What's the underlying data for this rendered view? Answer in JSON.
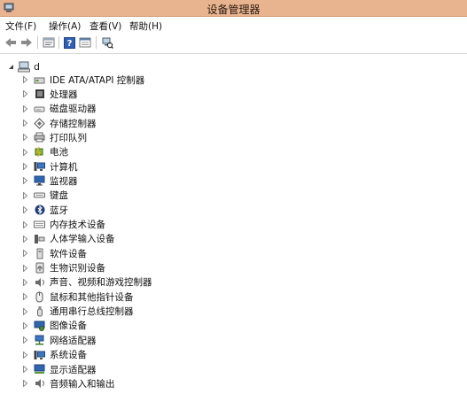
{
  "window": {
    "title": "设备管理器"
  },
  "menu": [
    {
      "label": "文件(F)"
    },
    {
      "label": "操作(A)"
    },
    {
      "label": "查看(V)"
    },
    {
      "label": "帮助(H)"
    }
  ],
  "toolbar": [
    {
      "icon": "back-arrow-icon"
    },
    {
      "icon": "forward-arrow-icon"
    },
    {
      "icon": "properties-icon"
    },
    {
      "icon": "help-icon"
    },
    {
      "icon": "details-view-icon"
    },
    {
      "icon": "scan-hardware-icon"
    }
  ],
  "tree": {
    "root_label": "d",
    "categories": [
      {
        "label": "IDE ATA/ATAPI 控制器",
        "icon": "ide-controller-icon"
      },
      {
        "label": "处理器",
        "icon": "processor-icon"
      },
      {
        "label": "磁盘驱动器",
        "icon": "disk-drive-icon"
      },
      {
        "label": "存储控制器",
        "icon": "storage-controller-icon"
      },
      {
        "label": "打印队列",
        "icon": "printer-icon"
      },
      {
        "label": "电池",
        "icon": "battery-icon"
      },
      {
        "label": "计算机",
        "icon": "computer-icon"
      },
      {
        "label": "监视器",
        "icon": "monitor-icon"
      },
      {
        "label": "键盘",
        "icon": "keyboard-icon"
      },
      {
        "label": "蓝牙",
        "icon": "bluetooth-icon"
      },
      {
        "label": "内存技术设备",
        "icon": "memory-device-icon"
      },
      {
        "label": "人体学输入设备",
        "icon": "hid-icon"
      },
      {
        "label": "软件设备",
        "icon": "software-device-icon"
      },
      {
        "label": "生物识别设备",
        "icon": "biometric-icon"
      },
      {
        "label": "声音、视频和游戏控制器",
        "icon": "sound-icon"
      },
      {
        "label": "鼠标和其他指针设备",
        "icon": "mouse-icon"
      },
      {
        "label": "通用串行总线控制器",
        "icon": "usb-icon"
      },
      {
        "label": "图像设备",
        "icon": "camera-icon"
      },
      {
        "label": "网络适配器",
        "icon": "network-adapter-icon"
      },
      {
        "label": "系统设备",
        "icon": "system-device-icon"
      },
      {
        "label": "显示适配器",
        "icon": "display-adapter-icon"
      },
      {
        "label": "音频输入和输出",
        "icon": "audio-io-icon"
      }
    ]
  }
}
